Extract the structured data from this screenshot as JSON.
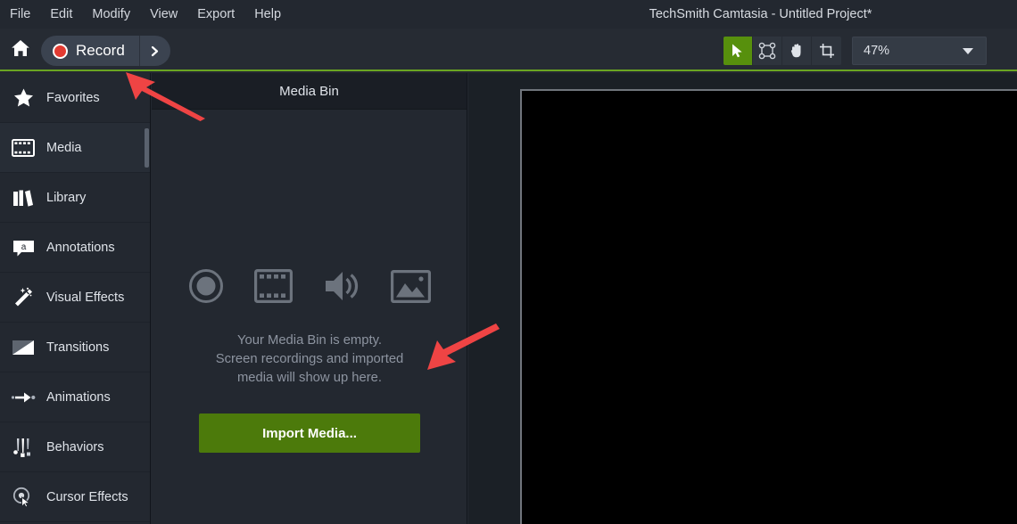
{
  "window": {
    "title": "TechSmith Camtasia - Untitled Project*"
  },
  "menubar": {
    "items": [
      {
        "label": "File"
      },
      {
        "label": "Edit"
      },
      {
        "label": "Modify"
      },
      {
        "label": "View"
      },
      {
        "label": "Export"
      },
      {
        "label": "Help"
      }
    ]
  },
  "toolbar": {
    "home_icon": "home-icon",
    "record_label": "Record",
    "record_icon": "record-dot-icon",
    "record_dropdown_icon": "chevron-right-icon",
    "tools": [
      {
        "name": "selection-tool",
        "icon": "cursor-arrow-icon",
        "active": true
      },
      {
        "name": "transform-tool",
        "icon": "transform-nodes-icon",
        "active": false
      },
      {
        "name": "pan-tool",
        "icon": "hand-icon",
        "active": false
      },
      {
        "name": "crop-tool",
        "icon": "crop-icon",
        "active": false
      }
    ],
    "zoom": {
      "value": "47%",
      "caret_icon": "chevron-down-icon"
    },
    "accent_green": "#6aa522",
    "record_red": "#e33b32"
  },
  "sidebar": {
    "items": [
      {
        "label": "Favorites",
        "icon": "star-icon",
        "active": false
      },
      {
        "label": "Media",
        "icon": "film-strip-icon",
        "active": true
      },
      {
        "label": "Library",
        "icon": "books-icon",
        "active": false
      },
      {
        "label": "Annotations",
        "icon": "callout-a-icon",
        "active": false
      },
      {
        "label": "Visual Effects",
        "icon": "magic-wand-icon",
        "active": false
      },
      {
        "label": "Transitions",
        "icon": "transition-icon",
        "active": false
      },
      {
        "label": "Animations",
        "icon": "arrow-animate-icon",
        "active": false
      },
      {
        "label": "Behaviors",
        "icon": "behaviors-icon",
        "active": false
      },
      {
        "label": "Cursor Effects",
        "icon": "cursor-effects-icon",
        "active": false
      }
    ]
  },
  "media_bin": {
    "title": "Media Bin",
    "empty_icons": [
      {
        "name": "record-circle-icon"
      },
      {
        "name": "film-strip-icon"
      },
      {
        "name": "audio-speaker-icon"
      },
      {
        "name": "image-icon"
      }
    ],
    "empty_text_line1": "Your Media Bin is empty.",
    "empty_text_line2": "Screen recordings and imported",
    "empty_text_line3": "media will show up here.",
    "import_button_label": "Import Media...",
    "import_button_color": "#4c7a0b"
  },
  "canvas": {
    "preview_background": "#000000"
  },
  "annotations": {
    "arrow_color": "#ef4444",
    "arrows": [
      {
        "name": "arrow-pointing-to-record",
        "direction": "up-left"
      },
      {
        "name": "arrow-pointing-to-import-media",
        "direction": "down-left"
      }
    ]
  }
}
